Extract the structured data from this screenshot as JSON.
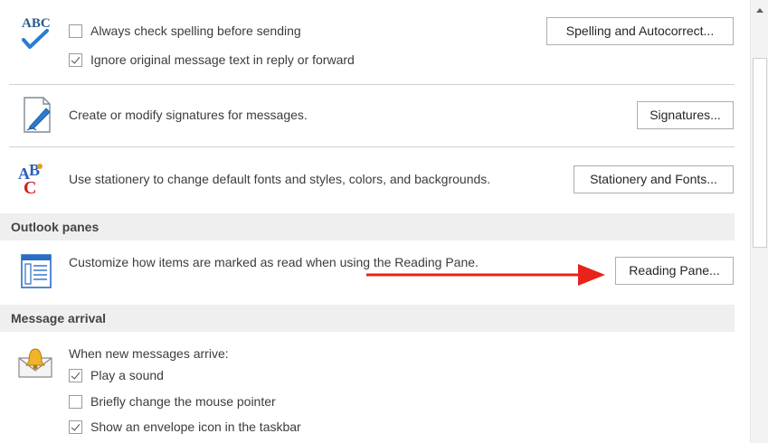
{
  "spelling": {
    "always_check_label": "Always check spelling before sending",
    "always_check_checked": false,
    "ignore_original_label": "Ignore original message text in reply or forward",
    "ignore_original_checked": true,
    "button_label": "Spelling and Autocorrect..."
  },
  "signatures": {
    "description": "Create or modify signatures for messages.",
    "button_label": "Signatures..."
  },
  "stationery": {
    "description": "Use stationery to change default fonts and styles, colors, and backgrounds.",
    "button_label": "Stationery and Fonts..."
  },
  "outlook_panes": {
    "header": "Outlook panes",
    "description": "Customize how items are marked as read when using the Reading Pane.",
    "button_label": "Reading Pane..."
  },
  "message_arrival": {
    "header": "Message arrival",
    "intro": "When new messages arrive:",
    "options": [
      {
        "label": "Play a sound",
        "checked": true
      },
      {
        "label": "Briefly change the mouse pointer",
        "checked": false
      },
      {
        "label": "Show an envelope icon in the taskbar",
        "checked": true
      }
    ]
  },
  "colors": {
    "annotation_arrow": "#e8231a",
    "check_blue": "#2b7bd3",
    "section_header_bg": "#efefef"
  }
}
